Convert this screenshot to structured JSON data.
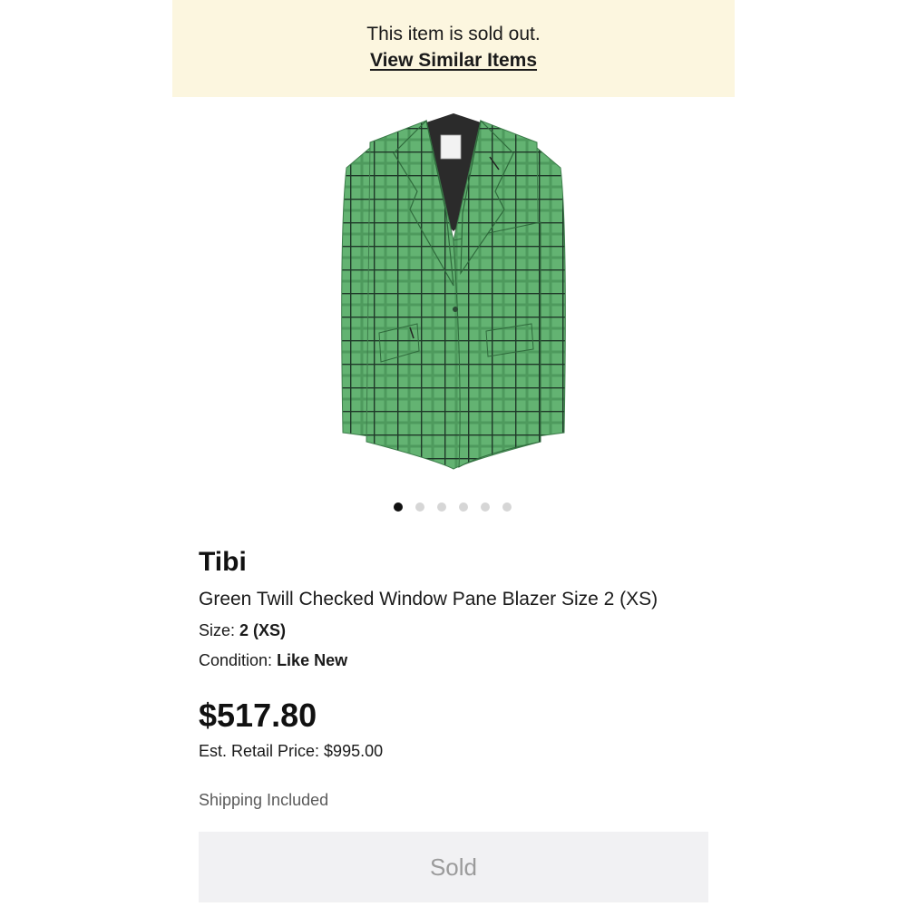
{
  "banner": {
    "message": "This item is sold out.",
    "link_label": "View Similar Items",
    "background": "#fcf6df"
  },
  "gallery": {
    "image": "green-plaid-blazer-photo",
    "dot_count": 6,
    "active_index": 0
  },
  "product": {
    "brand": "Tibi",
    "title": "Green Twill Checked Window Pane Blazer Size 2 (XS)",
    "size_label": "Size:",
    "size_value": "2 (XS)",
    "condition_label": "Condition:",
    "condition_value": "Like New",
    "price": "$517.80",
    "retail_price": "Est. Retail Price: $995.00",
    "shipping": "Shipping Included",
    "status_button": "Sold"
  },
  "colors": {
    "blazer_green": "#5fae6e",
    "grid_lines": "#1f3a2a",
    "sold_button_bg": "#f1f1f3",
    "sold_button_text": "#9b9b9b"
  }
}
